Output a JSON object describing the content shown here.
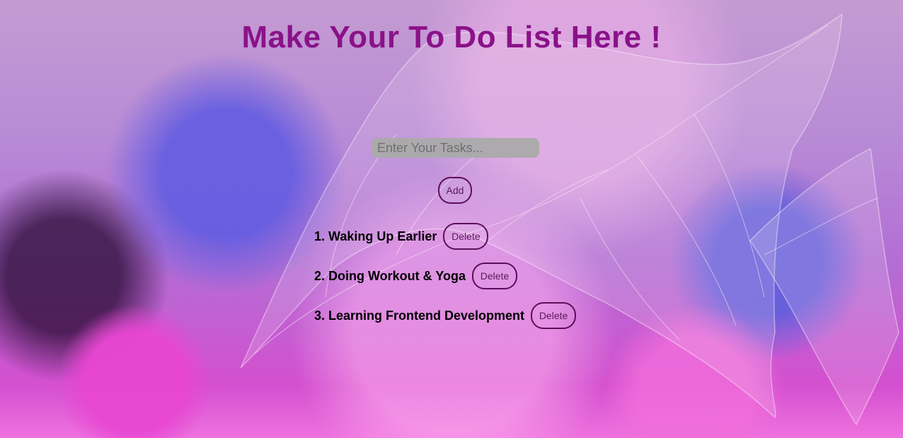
{
  "app": {
    "title": "Make Your To Do List Here !"
  },
  "task_input": {
    "placeholder": "Enter Your Tasks...",
    "value": ""
  },
  "buttons": {
    "add_label": "Add"
  },
  "tasks": [
    {
      "label": "1. Waking Up Earlier",
      "delete_label": "Delete"
    },
    {
      "label": "2. Doing Workout & Yoga",
      "delete_label": "Delete"
    },
    {
      "label": "3. Learning Frontend Development",
      "delete_label": "Delete"
    }
  ],
  "colors": {
    "title": "#8a1289",
    "button_border": "#5c0f58",
    "input_background": "#aaaaaa",
    "task_text": "#000000"
  }
}
